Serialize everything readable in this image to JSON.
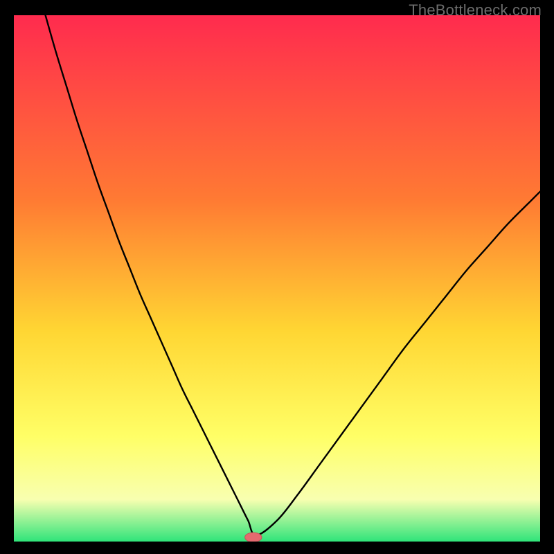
{
  "watermark": "TheBottleneck.com",
  "colors": {
    "frame": "#000000",
    "grad_top": "#ff2b4e",
    "grad_mid1": "#ff7a33",
    "grad_mid2": "#ffd633",
    "grad_low1": "#ffff66",
    "grad_low2": "#f8ffb0",
    "grad_bottom": "#2fe47a",
    "curve": "#000000",
    "marker_fill": "#e46a6f",
    "marker_stroke": "#c65559"
  },
  "chart_data": {
    "type": "line",
    "title": "",
    "xlabel": "",
    "ylabel": "",
    "xlim": [
      0,
      100
    ],
    "ylim": [
      0,
      100
    ],
    "series": [
      {
        "name": "bottleneck-curve",
        "x": [
          6,
          8,
          10,
          12,
          14,
          16,
          18,
          20,
          22,
          24,
          26,
          28,
          30,
          32,
          34,
          36,
          38,
          40,
          41.5,
          43,
          44.5,
          46,
          50,
          54,
          58,
          62,
          66,
          70,
          74,
          78,
          82,
          86,
          90,
          94,
          98,
          100
        ],
        "y": [
          100,
          93,
          86.5,
          80,
          74,
          68,
          62.5,
          57,
          52,
          47,
          42.5,
          38,
          33.5,
          29,
          25,
          21,
          17,
          13,
          10,
          7,
          4,
          1.2,
          4,
          9,
          14.5,
          20,
          25.5,
          31,
          36.5,
          41.5,
          46.5,
          51.5,
          56,
          60.5,
          64.5,
          66.5
        ]
      }
    ],
    "marker": {
      "x": 45.5,
      "y": 0.8,
      "rx": 1.6,
      "ry": 0.9
    },
    "gradient_stops": [
      {
        "offset": 0.0,
        "key": "grad_top"
      },
      {
        "offset": 0.35,
        "key": "grad_mid1"
      },
      {
        "offset": 0.6,
        "key": "grad_mid2"
      },
      {
        "offset": 0.8,
        "key": "grad_low1"
      },
      {
        "offset": 0.92,
        "key": "grad_low2"
      },
      {
        "offset": 1.0,
        "key": "grad_bottom"
      }
    ]
  }
}
